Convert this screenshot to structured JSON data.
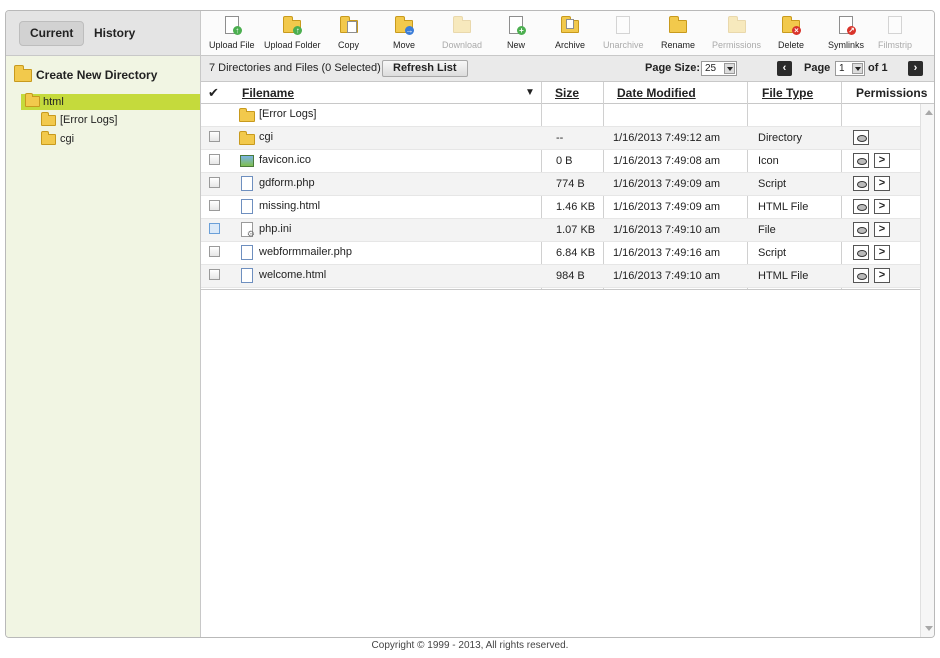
{
  "tabs": [
    {
      "label": "Current"
    },
    {
      "label": "History"
    }
  ],
  "toolbar": {
    "items": [
      {
        "label": "Upload File",
        "icon": "upload-file-icon",
        "enabled": true
      },
      {
        "label": "Upload Folder",
        "icon": "upload-folder-icon",
        "enabled": true
      },
      {
        "label": "Copy",
        "icon": "copy-icon",
        "enabled": true
      },
      {
        "label": "Move",
        "icon": "move-icon",
        "enabled": true
      },
      {
        "label": "Download",
        "icon": "download-icon",
        "enabled": false
      },
      {
        "label": "New",
        "icon": "new-icon",
        "enabled": true
      },
      {
        "label": "Archive",
        "icon": "archive-icon",
        "enabled": true
      },
      {
        "label": "Unarchive",
        "icon": "unarchive-icon",
        "enabled": false
      },
      {
        "label": "Rename",
        "icon": "rename-icon",
        "enabled": true
      },
      {
        "label": "Permissions",
        "icon": "permissions-icon",
        "enabled": false
      },
      {
        "label": "Delete",
        "icon": "delete-icon",
        "enabled": true
      },
      {
        "label": "Symlinks",
        "icon": "symlinks-icon",
        "enabled": true
      },
      {
        "label": "Filmstrip",
        "icon": "filmstrip-icon",
        "enabled": false
      }
    ]
  },
  "sidebar": {
    "create_label": "Create New Directory",
    "root": "html",
    "children": [
      "[Error Logs]",
      "cgi"
    ],
    "selected_color": "#c5da3c"
  },
  "status": {
    "summary": "7 Directories and Files (0 Selected)",
    "refresh_label": "Refresh List",
    "page_size_label": "Page Size:",
    "page_size_value": "25",
    "page_label": "Page",
    "page_value": "1",
    "of_label": "of 1",
    "prev_icon": "‹",
    "next_icon": "›"
  },
  "table": {
    "check_icon": "✔",
    "sort_icon": "▼",
    "columns": {
      "filename": "Filename",
      "size": "Size",
      "date": "Date Modified",
      "type": "File Type",
      "permissions": "Permissions"
    },
    "rows": [
      {
        "name": "[Error Logs]",
        "icon": "folder-up",
        "size": "",
        "date": "",
        "type": "",
        "checkbox": false,
        "perms": []
      },
      {
        "name": "cgi",
        "icon": "folder",
        "size": "--",
        "date": "1/16/2013 7:49:12 am",
        "type": "Directory",
        "checkbox": true,
        "perms": [
          "view"
        ]
      },
      {
        "name": "favicon.ico",
        "icon": "image",
        "size": "0 B",
        "date": "1/16/2013 7:49:08 am",
        "type": "Icon",
        "checkbox": true,
        "perms": [
          "view",
          "edit"
        ]
      },
      {
        "name": "gdform.php",
        "icon": "script",
        "size": "774 B",
        "date": "1/16/2013 7:49:09 am",
        "type": "Script",
        "checkbox": true,
        "perms": [
          "view",
          "edit"
        ]
      },
      {
        "name": "missing.html",
        "icon": "html",
        "size": "1.46 KB",
        "date": "1/16/2013 7:49:09 am",
        "type": "HTML File",
        "checkbox": true,
        "perms": [
          "view",
          "edit"
        ]
      },
      {
        "name": "php.ini",
        "icon": "ini",
        "size": "1.07 KB",
        "date": "1/16/2013 7:49:10 am",
        "type": "File",
        "checkbox": true,
        "perms": [
          "view",
          "edit"
        ]
      },
      {
        "name": "webformmailer.php",
        "icon": "script",
        "size": "6.84 KB",
        "date": "1/16/2013 7:49:16 am",
        "type": "Script",
        "checkbox": true,
        "perms": [
          "view",
          "edit"
        ]
      },
      {
        "name": "welcome.html",
        "icon": "html",
        "size": "984 B",
        "date": "1/16/2013 7:49:10 am",
        "type": "HTML File",
        "checkbox": true,
        "perms": [
          "view",
          "edit"
        ]
      }
    ]
  },
  "footer": {
    "copyright": "Copyright © 1999 - 2013, All rights reserved."
  }
}
